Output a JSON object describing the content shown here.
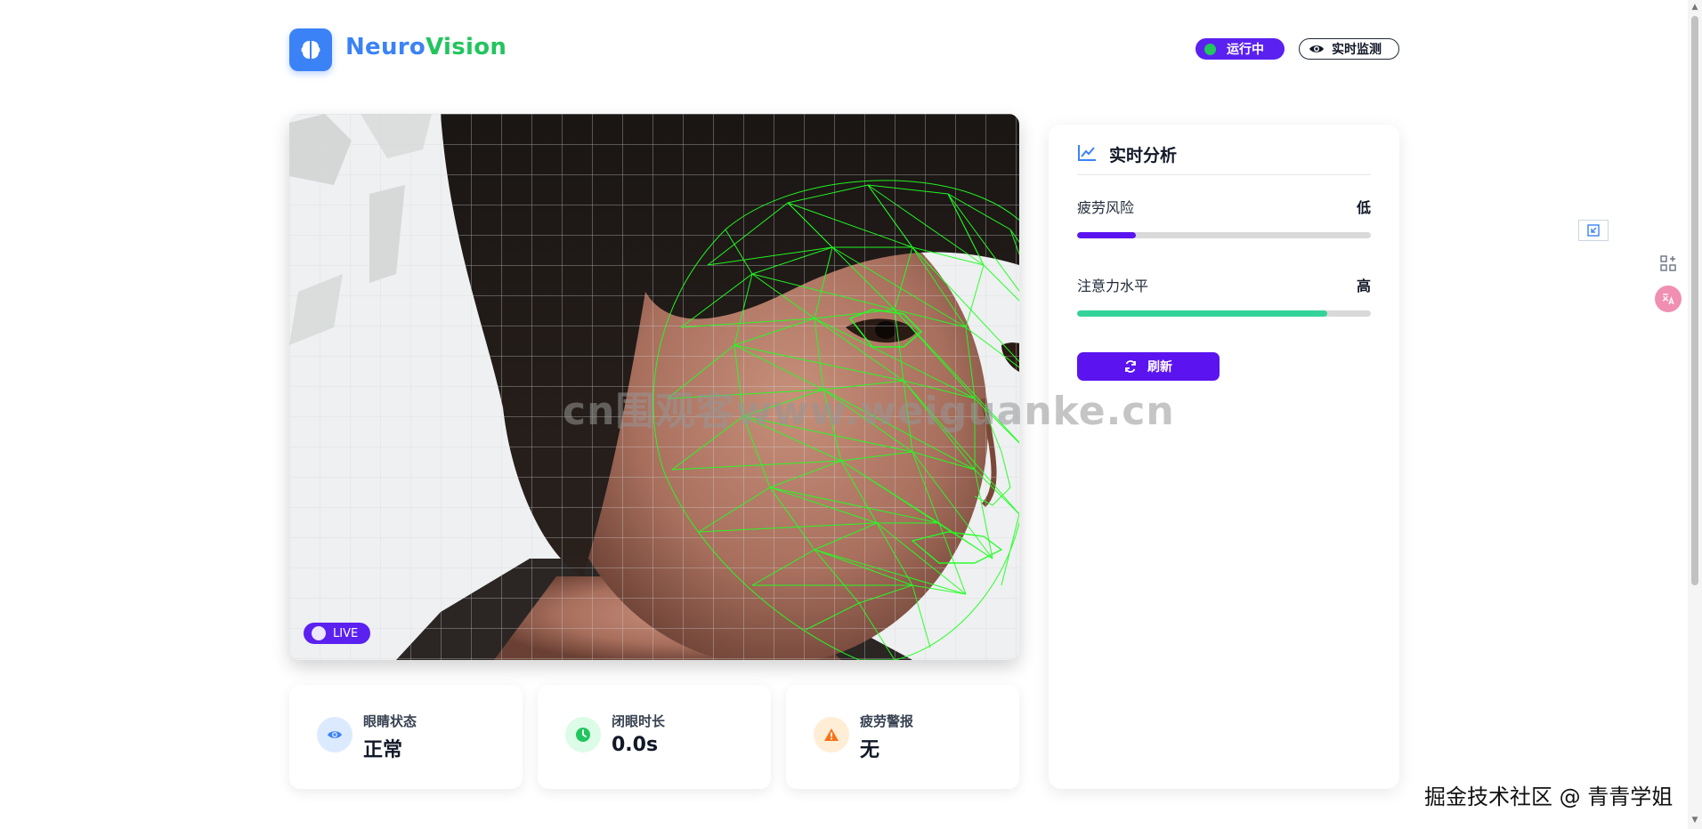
{
  "header": {
    "brand_part1": "Neuro",
    "brand_part2": "Vision",
    "logo_icon": "brain-icon",
    "status_label": "运行中",
    "monitor_label": "实时监测"
  },
  "video": {
    "live_label": "LIVE"
  },
  "stats": [
    {
      "label": "眼睛状态",
      "value": "正常",
      "icon": "eye-icon",
      "color": "#3b82f6"
    },
    {
      "label": "闭眼时长",
      "value": "0.0s",
      "icon": "clock-icon",
      "color": "#22c55e"
    },
    {
      "label": "疲劳警报",
      "value": "无",
      "icon": "warning-icon",
      "color": "#f97316"
    }
  ],
  "analysis": {
    "title": "实时分析",
    "icon": "chart-line-icon",
    "fatigue_risk": {
      "label": "疲劳风险",
      "value": "低",
      "level": 0.2,
      "color": "#5b14ef"
    },
    "attention": {
      "label": "注意力水平",
      "value": "高",
      "level": 0.85,
      "color": "#34d399"
    },
    "refresh_label": "刷新"
  },
  "overlay": {
    "watermark": "cn围观客www.weiguanke.cn",
    "credit": "掘金技术社区 @ 青青学姐"
  },
  "colors": {
    "primary": "#5b14ef",
    "brand_blue": "#3b82f6",
    "brand_green": "#22c55e",
    "mesh": "#22ff22"
  }
}
